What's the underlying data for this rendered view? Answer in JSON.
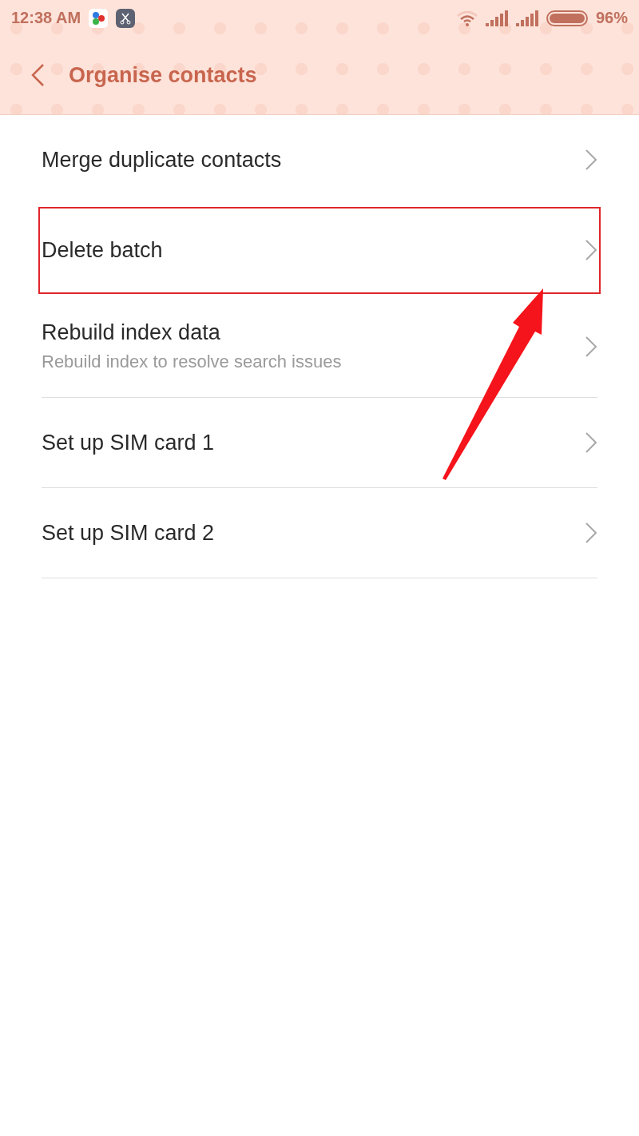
{
  "status_bar": {
    "time": "12:38 AM",
    "battery": "96%"
  },
  "header": {
    "title": "Organise contacts"
  },
  "items": [
    {
      "title": "Merge duplicate contacts",
      "highlighted": false,
      "divider": false
    },
    {
      "title": "Delete batch",
      "highlighted": true,
      "divider": false
    },
    {
      "title": "Rebuild index data",
      "subtitle": "Rebuild index to resolve search issues",
      "highlighted": false,
      "divider": true
    },
    {
      "title": "Set up SIM card 1",
      "highlighted": false,
      "divider": true
    },
    {
      "title": "Set up SIM card 2",
      "highlighted": false,
      "divider": true
    }
  ]
}
